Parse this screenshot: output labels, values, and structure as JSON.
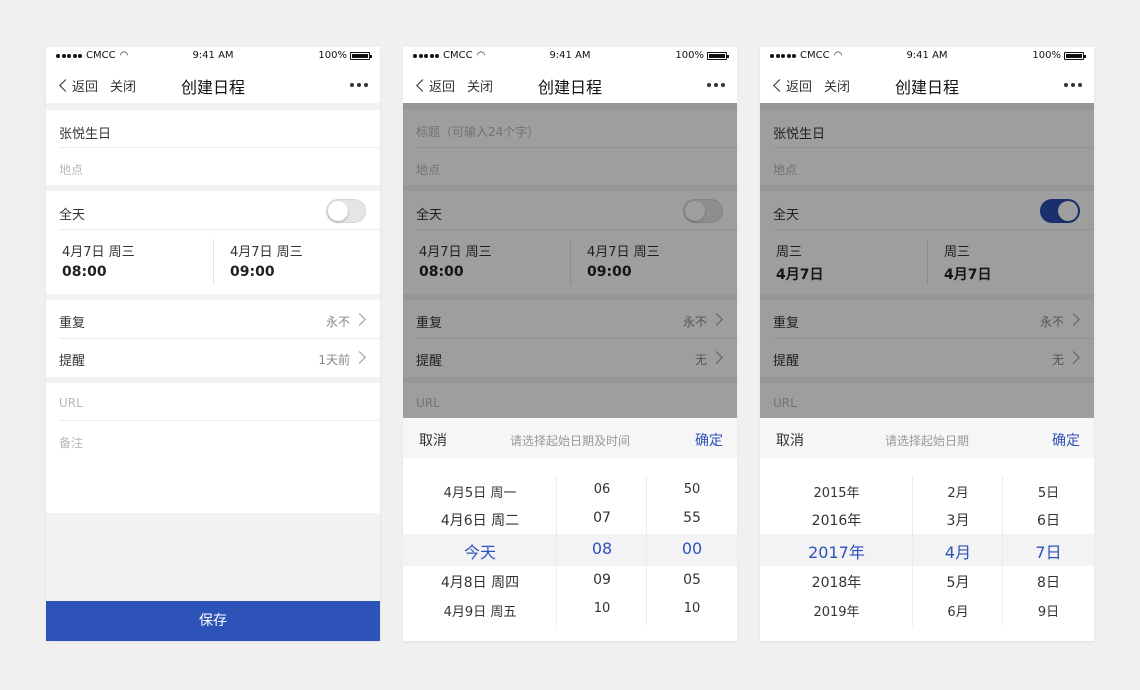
{
  "status": {
    "carrier": "CMCC",
    "time": "9:41 AM",
    "battery": "100%"
  },
  "nav": {
    "back": "返回",
    "close": "关闭",
    "title": "创建日程"
  },
  "screens": [
    {
      "title_value": "张悦生日",
      "location_placeholder": "地点",
      "allday_label": "全天",
      "allday_on": false,
      "start": {
        "line1": "4月7日  周三",
        "line2": "08:00"
      },
      "end": {
        "line1": "4月7日  周三",
        "line2": "09:00"
      },
      "repeat": {
        "label": "重复",
        "value": "永不"
      },
      "remind": {
        "label": "提醒",
        "value": "1天前"
      },
      "url_placeholder": "URL",
      "notes_placeholder": "备注",
      "save_label": "保存"
    },
    {
      "title_placeholder": "标题（可输入24个字）",
      "location_placeholder": "地点",
      "allday_label": "全天",
      "allday_on": false,
      "start": {
        "line1": "4月7日  周三",
        "line2": "08:00"
      },
      "end": {
        "line1": "4月7日  周三",
        "line2": "09:00"
      },
      "repeat": {
        "label": "重复",
        "value": "永不"
      },
      "remind": {
        "label": "提醒",
        "value": "无"
      },
      "url_placeholder": "URL",
      "picker": {
        "cancel": "取消",
        "hint": "请选择起始日期及时间",
        "ok": "确定",
        "columns": [
          [
            "4月5日  周一",
            "4月6日  周二",
            "今天",
            "4月8日  周四",
            "4月9日  周五"
          ],
          [
            "06",
            "07",
            "08",
            "09",
            "10"
          ],
          [
            "50",
            "55",
            "00",
            "05",
            "10"
          ]
        ]
      }
    },
    {
      "title_value": "张悦生日",
      "location_placeholder": "地点",
      "allday_label": "全天",
      "allday_on": true,
      "start": {
        "line1": "周三",
        "line2": "4月7日"
      },
      "end": {
        "line1": "周三",
        "line2": "4月7日"
      },
      "repeat": {
        "label": "重复",
        "value": "永不"
      },
      "remind": {
        "label": "提醒",
        "value": "无"
      },
      "url_placeholder": "URL",
      "picker": {
        "cancel": "取消",
        "hint": "请选择起始日期",
        "ok": "确定",
        "columns": [
          [
            "2015年",
            "2016年",
            "2017年",
            "2018年",
            "2019年"
          ],
          [
            "2月",
            "3月",
            "4月",
            "5月",
            "6月"
          ],
          [
            "5日",
            "6日",
            "7日",
            "8日",
            "9日"
          ]
        ]
      }
    }
  ]
}
